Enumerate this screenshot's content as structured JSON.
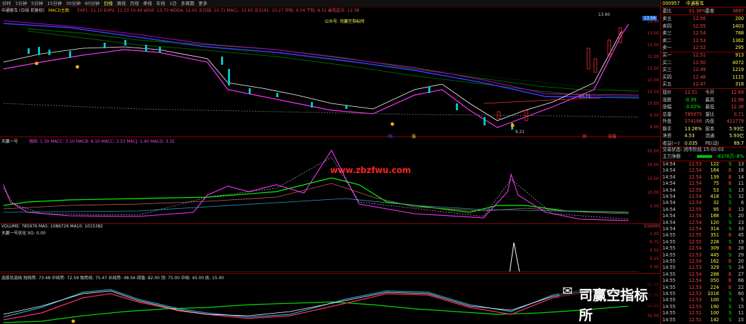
{
  "toolbar": {
    "items": [
      "分时",
      "1分钟",
      "5分钟",
      "15分钟",
      "30分钟",
      "60分钟",
      "日线",
      "周线",
      "月线",
      "季线",
      "年线",
      "1日",
      "多周期",
      "更多"
    ],
    "active": "日线",
    "stock_title": "中通客车 (日线 前复权)"
  },
  "main_chart": {
    "indicator_label": "MACD主图",
    "values": "EXP1: 11.10  EXP2: 11.33  10.49  WDIF: 13.70  WDEA: 12.05  五日线: 10.71  MACL: 13.65  五3191: 10.27  中轨: 9.04  下轨: 8.51  最低起点: 12.38",
    "note": "公众号: 司赢空指标所",
    "price_high": "13.90",
    "price_low": "9.21",
    "current_price": "13.56",
    "current_date_label": "10.71",
    "marks": [
      "明",
      "涨",
      "预",
      "涨幅"
    ],
    "y_ticks": [
      "13.50",
      "13.00",
      "12.50",
      "12.00",
      "11.50",
      "11.00",
      "10.50",
      "10.00",
      "9.50",
      "9.00"
    ]
  },
  "panel2": {
    "label": "天赢一号",
    "values": "强线: 1.30  MACC: 3.10  MACB: 6.10  MACC: 3.53  MACJ: 1.40  MACD: 3.32",
    "y_ticks": [
      "25.00",
      "20.00",
      "15.00",
      "10.00",
      "5.00"
    ],
    "watermark_text": "www.zbzfwu.com"
  },
  "panel3": {
    "label1": "VOLUME: 785976  MA5: 1086729  MA10: 1015382",
    "label2": "天赢一号优化 XG: 0.00",
    "y_ticks": [
      "1.00",
      "0.75",
      "0.50",
      "0.25",
      "0.00"
    ],
    "unit": "X10000"
  },
  "panel4": {
    "label": "选股优选线  短线势: 73.48  中线势: 72.59  强势线: 75.47  长线势: 48.56  阈值: 82.00  顶: 75.00  中线: 45.00  底: 15.00",
    "y_ticks": [
      "95.00",
      "75.00",
      "55.00",
      "35.00"
    ],
    "brand_text": "司赢空指标所"
  },
  "quote": {
    "code": "000957",
    "name": "中通客车",
    "weibi_label": "委比",
    "weibi_value": "31.38%",
    "weicha_label": "委差",
    "weicha_value": "3697",
    "asks": [
      {
        "label": "卖五",
        "price": "12.56",
        "vol": "200"
      },
      {
        "label": "卖四",
        "price": "12.55",
        "vol": "1403"
      },
      {
        "label": "卖三",
        "price": "12.54",
        "vol": "788"
      },
      {
        "label": "卖二",
        "price": "12.53",
        "vol": "1362"
      },
      {
        "label": "卖一",
        "price": "12.52",
        "vol": "295"
      }
    ],
    "bids": [
      {
        "label": "买一",
        "price": "12.51",
        "vol": "913"
      },
      {
        "label": "买二",
        "price": "12.50",
        "vol": "4072"
      },
      {
        "label": "买三",
        "price": "12.49",
        "vol": "1219"
      },
      {
        "label": "买四",
        "price": "12.48",
        "vol": "1115"
      },
      {
        "label": "买五",
        "price": "12.47",
        "vol": "318"
      }
    ],
    "stats": [
      {
        "l1": "现价",
        "v1": "12.51",
        "l2": "今开",
        "v2": "12.69"
      },
      {
        "l1": "涨跌",
        "v1": "-0.39",
        "l2": "最高",
        "v2": "12.96"
      },
      {
        "l1": "涨幅",
        "v1": "-3.02%",
        "l2": "最低",
        "v2": "12.38"
      },
      {
        "l1": "总量",
        "v1": "785975",
        "l2": "量比",
        "v2": "0.71"
      },
      {
        "l1": "外盘",
        "v1": "374196",
        "l2": "内盘",
        "v2": "411779"
      },
      {
        "l1": "换手",
        "v1": "13.26%",
        "l2": "股本",
        "v2": "5.93亿"
      },
      {
        "l1": "净资",
        "v1": "4.53",
        "l2": "流通",
        "v2": "5.93亿"
      },
      {
        "l1": "收益(一)",
        "v1": "0.035",
        "l2": "PE(动)",
        "v2": "89.7"
      }
    ],
    "trade_status": "交易状态: 闭市阶段 15:00:03",
    "main_flow_label": "主力净额",
    "main_flow_value": "-8376万",
    "main_flow_pct": "-8%",
    "ticks": [
      [
        "14:54",
        "12.53",
        "122",
        "S",
        "13"
      ],
      [
        "14:54",
        "12.54",
        "164",
        "B",
        "18"
      ],
      [
        "14:54",
        "12.54",
        "139",
        "B",
        "14"
      ],
      [
        "14:54",
        "12.54",
        "75",
        "B",
        "11"
      ],
      [
        "14:54",
        "12.55",
        "53",
        "S",
        "13"
      ],
      [
        "14:54",
        "12.54",
        "418",
        "S",
        "32"
      ],
      [
        "14:54",
        "12.54",
        "32",
        "S",
        "6"
      ],
      [
        "14:54",
        "12.55",
        "95",
        "B",
        "13"
      ],
      [
        "14:54",
        "12.54",
        "188",
        "S",
        "20"
      ],
      [
        "14:54",
        "12.54",
        "120",
        "S",
        "23"
      ],
      [
        "14:54",
        "12.54",
        "314",
        "S",
        "33"
      ],
      [
        "14:55",
        "12.55",
        "351",
        "B",
        "45"
      ],
      [
        "14:55",
        "12.55",
        "228",
        "S",
        "19"
      ],
      [
        "14:55",
        "12.54",
        "309",
        "B",
        "28"
      ],
      [
        "14:55",
        "12.53",
        "445",
        "S",
        "29"
      ],
      [
        "14:55",
        "12.54",
        "162",
        "B",
        "20"
      ],
      [
        "14:55",
        "12.53",
        "329",
        "S",
        "24"
      ],
      [
        "14:55",
        "12.54",
        "288",
        "B",
        "27"
      ],
      [
        "14:55",
        "12.54",
        "050",
        "B",
        "66"
      ],
      [
        "14:55",
        "12.53",
        "224",
        "B",
        "22"
      ],
      [
        "14:55",
        "12.53",
        "1016",
        "S",
        "60"
      ],
      [
        "14:55",
        "12.53",
        "100",
        "S",
        "5"
      ],
      [
        "14:55",
        "12.53",
        "190",
        "S",
        "15"
      ],
      [
        "14:55",
        "12.51",
        "100",
        "S",
        "11"
      ],
      [
        "14:55",
        "12.51",
        "142",
        "S",
        "15"
      ]
    ]
  }
}
